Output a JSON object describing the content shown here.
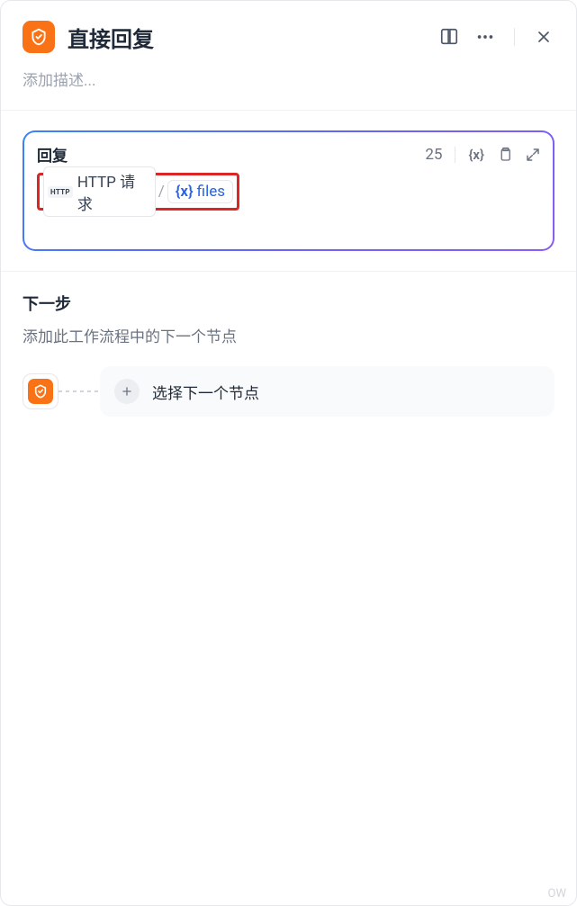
{
  "header": {
    "title": "直接回复",
    "icon": "reply-shield-icon"
  },
  "description": {
    "placeholder": "添加描述..."
  },
  "reply": {
    "title": "回复",
    "count": "25",
    "http_badge_prefix": "HTTP",
    "http_badge_text": "HTTP 请求",
    "separator": "/",
    "var_icon": "{x}",
    "var_name": "files"
  },
  "next": {
    "title": "下一步",
    "subtitle": "添加此工作流程中的下一个节点",
    "select_label": "选择下一个节点"
  },
  "watermark": "OW"
}
